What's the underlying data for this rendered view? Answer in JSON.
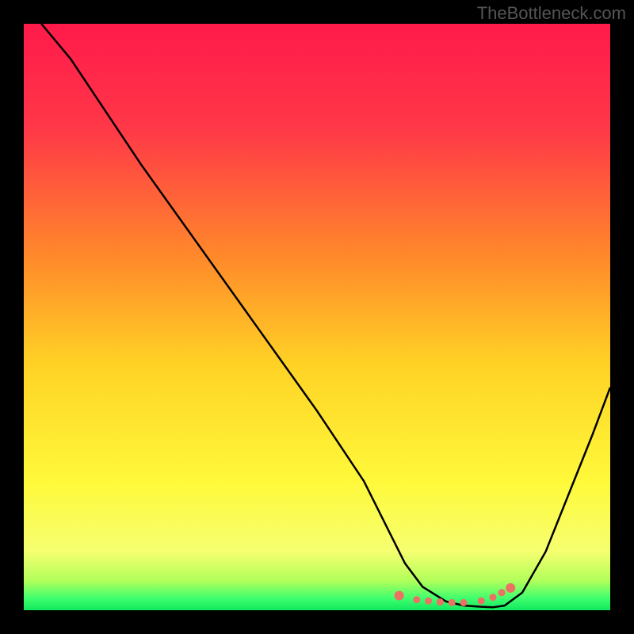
{
  "attribution": "TheBottleneck.com",
  "chart_data": {
    "type": "line",
    "title": "",
    "xlabel": "",
    "ylabel": "",
    "xlim": [
      0,
      100
    ],
    "ylim": [
      0,
      100
    ],
    "series": [
      {
        "name": "bottleneck-curve",
        "x": [
          3,
          8,
          12,
          20,
          30,
          40,
          50,
          58,
          62,
          65,
          68,
          72,
          75,
          78,
          80,
          82,
          85,
          89,
          93,
          97,
          100
        ],
        "y": [
          100,
          94,
          88,
          76,
          62,
          48,
          34,
          22,
          14,
          8,
          4,
          1.5,
          0.8,
          0.6,
          0.5,
          0.8,
          3,
          10,
          20,
          30,
          38
        ]
      },
      {
        "name": "optimum-dots",
        "x": [
          64,
          67,
          69,
          71,
          73,
          75,
          78,
          80,
          81.5,
          83
        ],
        "y": [
          2.5,
          1.8,
          1.6,
          1.4,
          1.3,
          1.3,
          1.6,
          2.2,
          3,
          3.8
        ]
      }
    ],
    "gradient_stops": [
      {
        "offset": 0,
        "color": "#ff1a4a"
      },
      {
        "offset": 18,
        "color": "#ff3848"
      },
      {
        "offset": 40,
        "color": "#ff8a2a"
      },
      {
        "offset": 58,
        "color": "#ffd225"
      },
      {
        "offset": 78,
        "color": "#fff93a"
      },
      {
        "offset": 90,
        "color": "#f6ff70"
      },
      {
        "offset": 95,
        "color": "#b0ff5a"
      },
      {
        "offset": 98,
        "color": "#3eff6e"
      },
      {
        "offset": 100,
        "color": "#12e85e"
      }
    ],
    "dot_color": "#ec7063"
  }
}
